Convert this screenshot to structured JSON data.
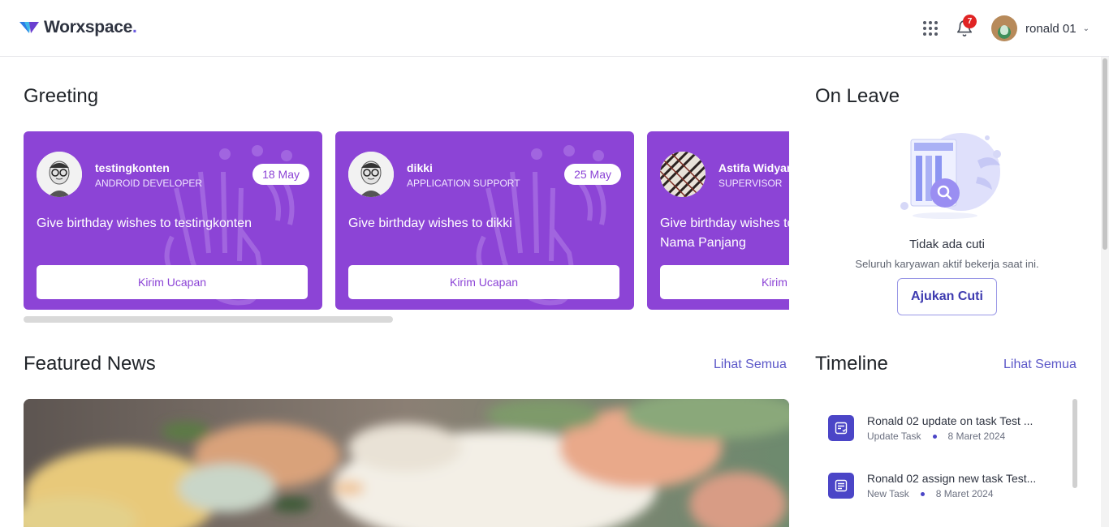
{
  "app": {
    "logo_text": "Worxspace",
    "logo_dot": "."
  },
  "header": {
    "notification_count": "7",
    "user_name": "ronald 01",
    "icons": [
      "apps-grid-icon",
      "bell-icon",
      "chevron-down-icon"
    ]
  },
  "greeting": {
    "title": "Greeting",
    "cards": [
      {
        "name": "testingkonten",
        "role": "ANDROID DEVELOPER",
        "date": "18 May",
        "message": "Give birthday wishes to testingkonten",
        "button": "Kirim Ucapan"
      },
      {
        "name": "dikki",
        "role": "APPLICATION SUPPORT",
        "date": "25 May",
        "message": "Give birthday wishes to dikki",
        "button": "Kirim Ucapan"
      },
      {
        "name": "Astifa Widyan",
        "role": "SUPERVISOR",
        "date": "",
        "message": "Give birthday wishes to Astifa Widyan Nama Panjang",
        "button": "Kirim Ucapan"
      }
    ]
  },
  "on_leave": {
    "title": "On Leave",
    "empty_title": "Tidak ada cuti",
    "empty_subtitle": "Seluruh karyawan aktif bekerja saat ini.",
    "button": "Ajukan Cuti"
  },
  "featured_news": {
    "title": "Featured News",
    "see_all": "Lihat Semua"
  },
  "timeline": {
    "title": "Timeline",
    "see_all": "Lihat Semua",
    "items": [
      {
        "title": "Ronald 02 update on task Test ...",
        "type": "Update Task",
        "date": "8 Maret 2024"
      },
      {
        "title": "Ronald 02 assign new task Test...",
        "type": "New Task",
        "date": "8 Maret 2024"
      }
    ]
  },
  "colors": {
    "accent": "#8c44d6",
    "primary": "#4b45c7",
    "link": "#5b57c8",
    "badge": "#e02424"
  }
}
